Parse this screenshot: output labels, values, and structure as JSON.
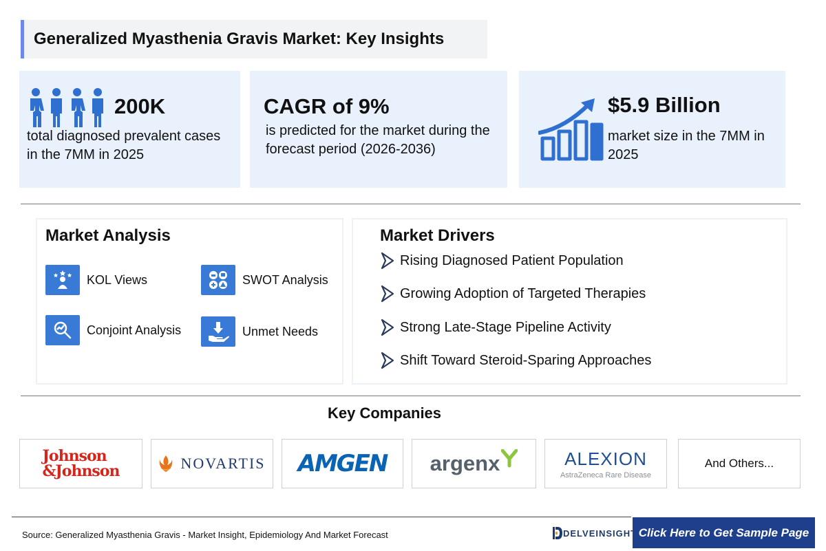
{
  "title": "Generalized Myasthenia Gravis Market: Key Insights",
  "stats": [
    {
      "value": "200K",
      "description": "total diagnosed prevalent cases in the 7MM in 2025",
      "icon": "people-icon"
    },
    {
      "value": "CAGR of 9%",
      "description": "is predicted for the market during the forecast period (2026-2036)"
    },
    {
      "value": "$5.9 Billion",
      "description": "market size in the 7MM in 2025",
      "icon": "growth-chart-icon"
    }
  ],
  "market_analysis": {
    "heading": "Market Analysis",
    "items": [
      {
        "label": "KOL Views",
        "icon": "kol-icon"
      },
      {
        "label": "SWOT Analysis",
        "icon": "swot-icon"
      },
      {
        "label": "Conjoint Analysis",
        "icon": "conjoint-icon"
      },
      {
        "label": "Unmet Needs",
        "icon": "unmet-needs-icon"
      }
    ]
  },
  "market_drivers": {
    "heading": "Market Drivers",
    "items": [
      "Rising Diagnosed Patient Population",
      "Growing Adoption of Targeted Therapies",
      "Strong Late-Stage Pipeline Activity",
      "Shift Toward Steroid-Sparing Approaches"
    ]
  },
  "key_companies": {
    "heading": "Key Companies",
    "logos": [
      {
        "line1": "Johnson",
        "line2": "&Johnson"
      },
      {
        "name": "NOVARTIS"
      },
      {
        "name": "AMGEN"
      },
      {
        "name": "argenx"
      },
      {
        "name": "ALEXION",
        "sub": "AstraZeneca Rare Disease"
      }
    ],
    "others": "And Others..."
  },
  "footer": {
    "source": "Source: Generalized Myasthenia Gravis - Market Insight, Epidemiology And Market Forecast",
    "brand": "DELVEINSIGHT",
    "cta": "Click Here to Get Sample Page"
  },
  "colors": {
    "accent": "#6f86ea",
    "card_bg": "#e8f1fc",
    "icon_blue": "#3a7ad7",
    "cta_bg": "#1e3f8c",
    "jnj_red": "#d5261d",
    "amgen_blue": "#0a63b3"
  }
}
